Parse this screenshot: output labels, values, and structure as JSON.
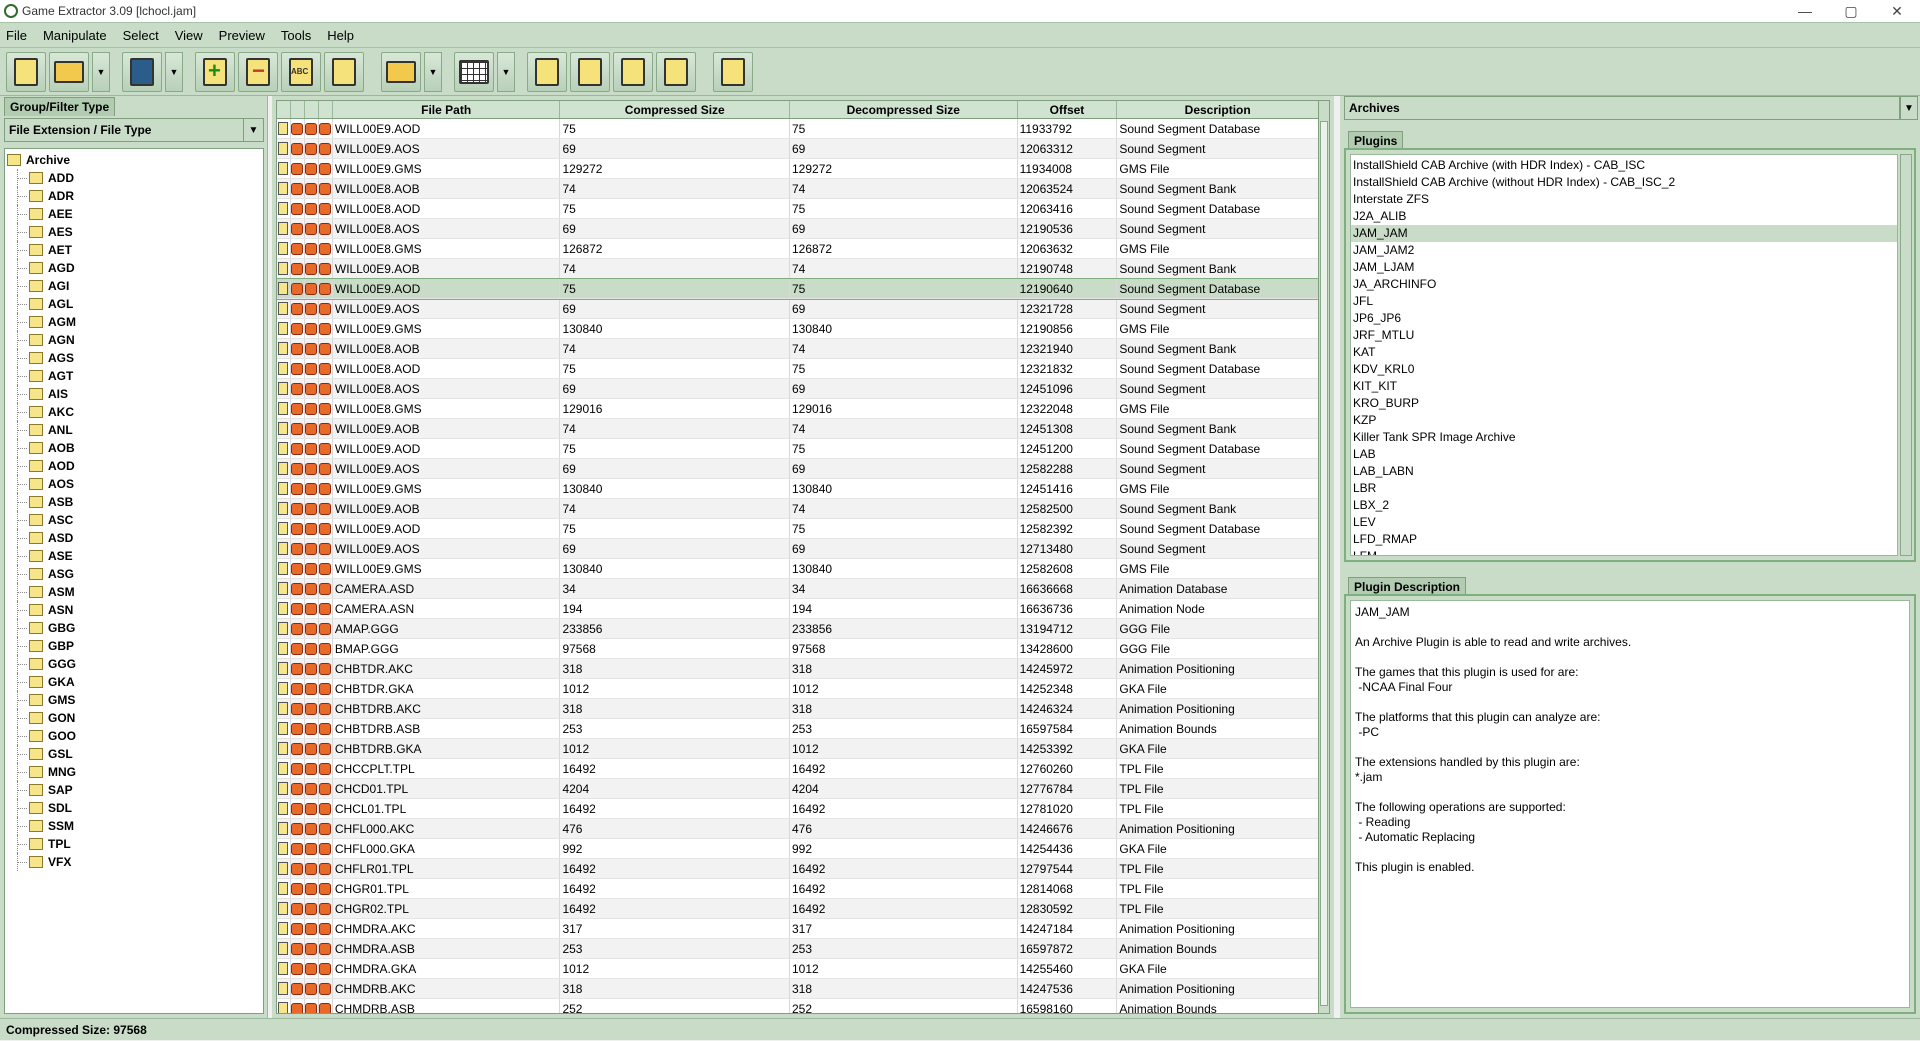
{
  "window": {
    "title": "Game Extractor 3.09 [lchocl.jam]",
    "controls": [
      "—",
      "▢",
      "✕"
    ]
  },
  "menu": [
    "File",
    "Manipulate",
    "Select",
    "View",
    "Preview",
    "Tools",
    "Help"
  ],
  "toolbar": {
    "buttons": [
      "new-archive",
      "open-archive",
      "save-archive",
      "add-files",
      "remove-files",
      "rename-files",
      "extract",
      "extract-all",
      "view-table",
      "edit",
      "plugins",
      "search",
      "help",
      "info"
    ]
  },
  "left_panel": {
    "tab_label": "Group/Filter Type",
    "combo_value": "File Extension / File Type",
    "tree_root": "Archive",
    "tree_items": [
      "ADD",
      "ADR",
      "AEE",
      "AES",
      "AET",
      "AGD",
      "AGI",
      "AGL",
      "AGM",
      "AGN",
      "AGS",
      "AGT",
      "AIS",
      "AKC",
      "ANL",
      "AOB",
      "AOD",
      "AOS",
      "ASB",
      "ASC",
      "ASD",
      "ASE",
      "ASG",
      "ASM",
      "ASN",
      "GBG",
      "GBP",
      "GGG",
      "GKA",
      "GMS",
      "GON",
      "GOO",
      "GSL",
      "MNG",
      "SAP",
      "SDL",
      "SSM",
      "TPL",
      "VFX"
    ]
  },
  "table": {
    "columns": [
      "File Path",
      "Compressed Size",
      "Decompressed Size",
      "Offset",
      "Description"
    ],
    "selected_index": 8,
    "rows": [
      [
        "WILL00E9.AOD",
        "75",
        "75",
        "11933792",
        "Sound Segment Database"
      ],
      [
        "WILL00E9.AOS",
        "69",
        "69",
        "12063312",
        "Sound Segment"
      ],
      [
        "WILL00E9.GMS",
        "129272",
        "129272",
        "11934008",
        "GMS File"
      ],
      [
        "WILL00E8.AOB",
        "74",
        "74",
        "12063524",
        "Sound Segment Bank"
      ],
      [
        "WILL00E8.AOD",
        "75",
        "75",
        "12063416",
        "Sound Segment Database"
      ],
      [
        "WILL00E8.AOS",
        "69",
        "69",
        "12190536",
        "Sound Segment"
      ],
      [
        "WILL00E8.GMS",
        "126872",
        "126872",
        "12063632",
        "GMS File"
      ],
      [
        "WILL00E9.AOB",
        "74",
        "74",
        "12190748",
        "Sound Segment Bank"
      ],
      [
        "WILL00E9.AOD",
        "75",
        "75",
        "12190640",
        "Sound Segment Database"
      ],
      [
        "WILL00E9.AOS",
        "69",
        "69",
        "12321728",
        "Sound Segment"
      ],
      [
        "WILL00E9.GMS",
        "130840",
        "130840",
        "12190856",
        "GMS File"
      ],
      [
        "WILL00E8.AOB",
        "74",
        "74",
        "12321940",
        "Sound Segment Bank"
      ],
      [
        "WILL00E8.AOD",
        "75",
        "75",
        "12321832",
        "Sound Segment Database"
      ],
      [
        "WILL00E8.AOS",
        "69",
        "69",
        "12451096",
        "Sound Segment"
      ],
      [
        "WILL00E8.GMS",
        "129016",
        "129016",
        "12322048",
        "GMS File"
      ],
      [
        "WILL00E9.AOB",
        "74",
        "74",
        "12451308",
        "Sound Segment Bank"
      ],
      [
        "WILL00E9.AOD",
        "75",
        "75",
        "12451200",
        "Sound Segment Database"
      ],
      [
        "WILL00E9.AOS",
        "69",
        "69",
        "12582288",
        "Sound Segment"
      ],
      [
        "WILL00E9.GMS",
        "130840",
        "130840",
        "12451416",
        "GMS File"
      ],
      [
        "WILL00E9.AOB",
        "74",
        "74",
        "12582500",
        "Sound Segment Bank"
      ],
      [
        "WILL00E9.AOD",
        "75",
        "75",
        "12582392",
        "Sound Segment Database"
      ],
      [
        "WILL00E9.AOS",
        "69",
        "69",
        "12713480",
        "Sound Segment"
      ],
      [
        "WILL00E9.GMS",
        "130840",
        "130840",
        "12582608",
        "GMS File"
      ],
      [
        "CAMERA.ASD",
        "34",
        "34",
        "16636668",
        "Animation Database"
      ],
      [
        "CAMERA.ASN",
        "194",
        "194",
        "16636736",
        "Animation Node"
      ],
      [
        "AMAP.GGG",
        "233856",
        "233856",
        "13194712",
        "GGG File"
      ],
      [
        "BMAP.GGG",
        "97568",
        "97568",
        "13428600",
        "GGG File"
      ],
      [
        "CHBTDR.AKC",
        "318",
        "318",
        "14245972",
        "Animation Positioning"
      ],
      [
        "CHBTDR.GKA",
        "1012",
        "1012",
        "14252348",
        "GKA File"
      ],
      [
        "CHBTDRB.AKC",
        "318",
        "318",
        "14246324",
        "Animation Positioning"
      ],
      [
        "CHBTDRB.ASB",
        "253",
        "253",
        "16597584",
        "Animation Bounds"
      ],
      [
        "CHBTDRB.GKA",
        "1012",
        "1012",
        "14253392",
        "GKA File"
      ],
      [
        "CHCCPLT.TPL",
        "16492",
        "16492",
        "12760260",
        "TPL File"
      ],
      [
        "CHCD01.TPL",
        "4204",
        "4204",
        "12776784",
        "TPL File"
      ],
      [
        "CHCL01.TPL",
        "16492",
        "16492",
        "12781020",
        "TPL File"
      ],
      [
        "CHFL000.AKC",
        "476",
        "476",
        "14246676",
        "Animation Positioning"
      ],
      [
        "CHFL000.GKA",
        "992",
        "992",
        "14254436",
        "GKA File"
      ],
      [
        "CHFLR01.TPL",
        "16492",
        "16492",
        "12797544",
        "TPL File"
      ],
      [
        "CHGR01.TPL",
        "16492",
        "16492",
        "12814068",
        "TPL File"
      ],
      [
        "CHGR02.TPL",
        "16492",
        "16492",
        "12830592",
        "TPL File"
      ],
      [
        "CHMDRA.AKC",
        "317",
        "317",
        "14247184",
        "Animation Positioning"
      ],
      [
        "CHMDRA.ASB",
        "253",
        "253",
        "16597872",
        "Animation Bounds"
      ],
      [
        "CHMDRA.GKA",
        "1012",
        "1012",
        "14255460",
        "GKA File"
      ],
      [
        "CHMDRB.AKC",
        "318",
        "318",
        "14247536",
        "Animation Positioning"
      ],
      [
        "CHMDRB.ASB",
        "252",
        "252",
        "16598160",
        "Animation Bounds"
      ]
    ]
  },
  "right_panel": {
    "archives_label": "Archives",
    "plugins_tab": "Plugins",
    "plugins": [
      "InstallShield CAB Archive (with HDR Index) - CAB_ISC",
      "InstallShield CAB Archive (without HDR Index) - CAB_ISC_2",
      "Interstate ZFS",
      "J2A_ALIB",
      "JAM_JAM",
      "JAM_JAM2",
      "JAM_LJAM",
      "JA_ARCHINFO",
      "JFL",
      "JP6_JP6",
      "JRF_MTLU",
      "KAT",
      "KDV_KRL0",
      "KIT_KIT",
      "KRO_BURP",
      "KZP",
      "Killer Tank SPR Image Archive",
      "LAB",
      "LAB_LABN",
      "LBR",
      "LBX_2",
      "LEV",
      "LFD_RMAP",
      "LFM"
    ],
    "selected_plugin": 4,
    "desc_tab": "Plugin Description",
    "description": "JAM_JAM\n\nAn Archive Plugin is able to read and write archives.\n\nThe games that this plugin is used for are:\n -NCAA Final Four\n\nThe platforms that this plugin can analyze are:\n -PC\n\nThe extensions handled by this plugin are:\n*.jam\n\nThe following operations are supported:\n - Reading\n - Automatic Replacing\n\nThis plugin is enabled."
  },
  "status": {
    "text": "Compressed Size: 97568"
  }
}
